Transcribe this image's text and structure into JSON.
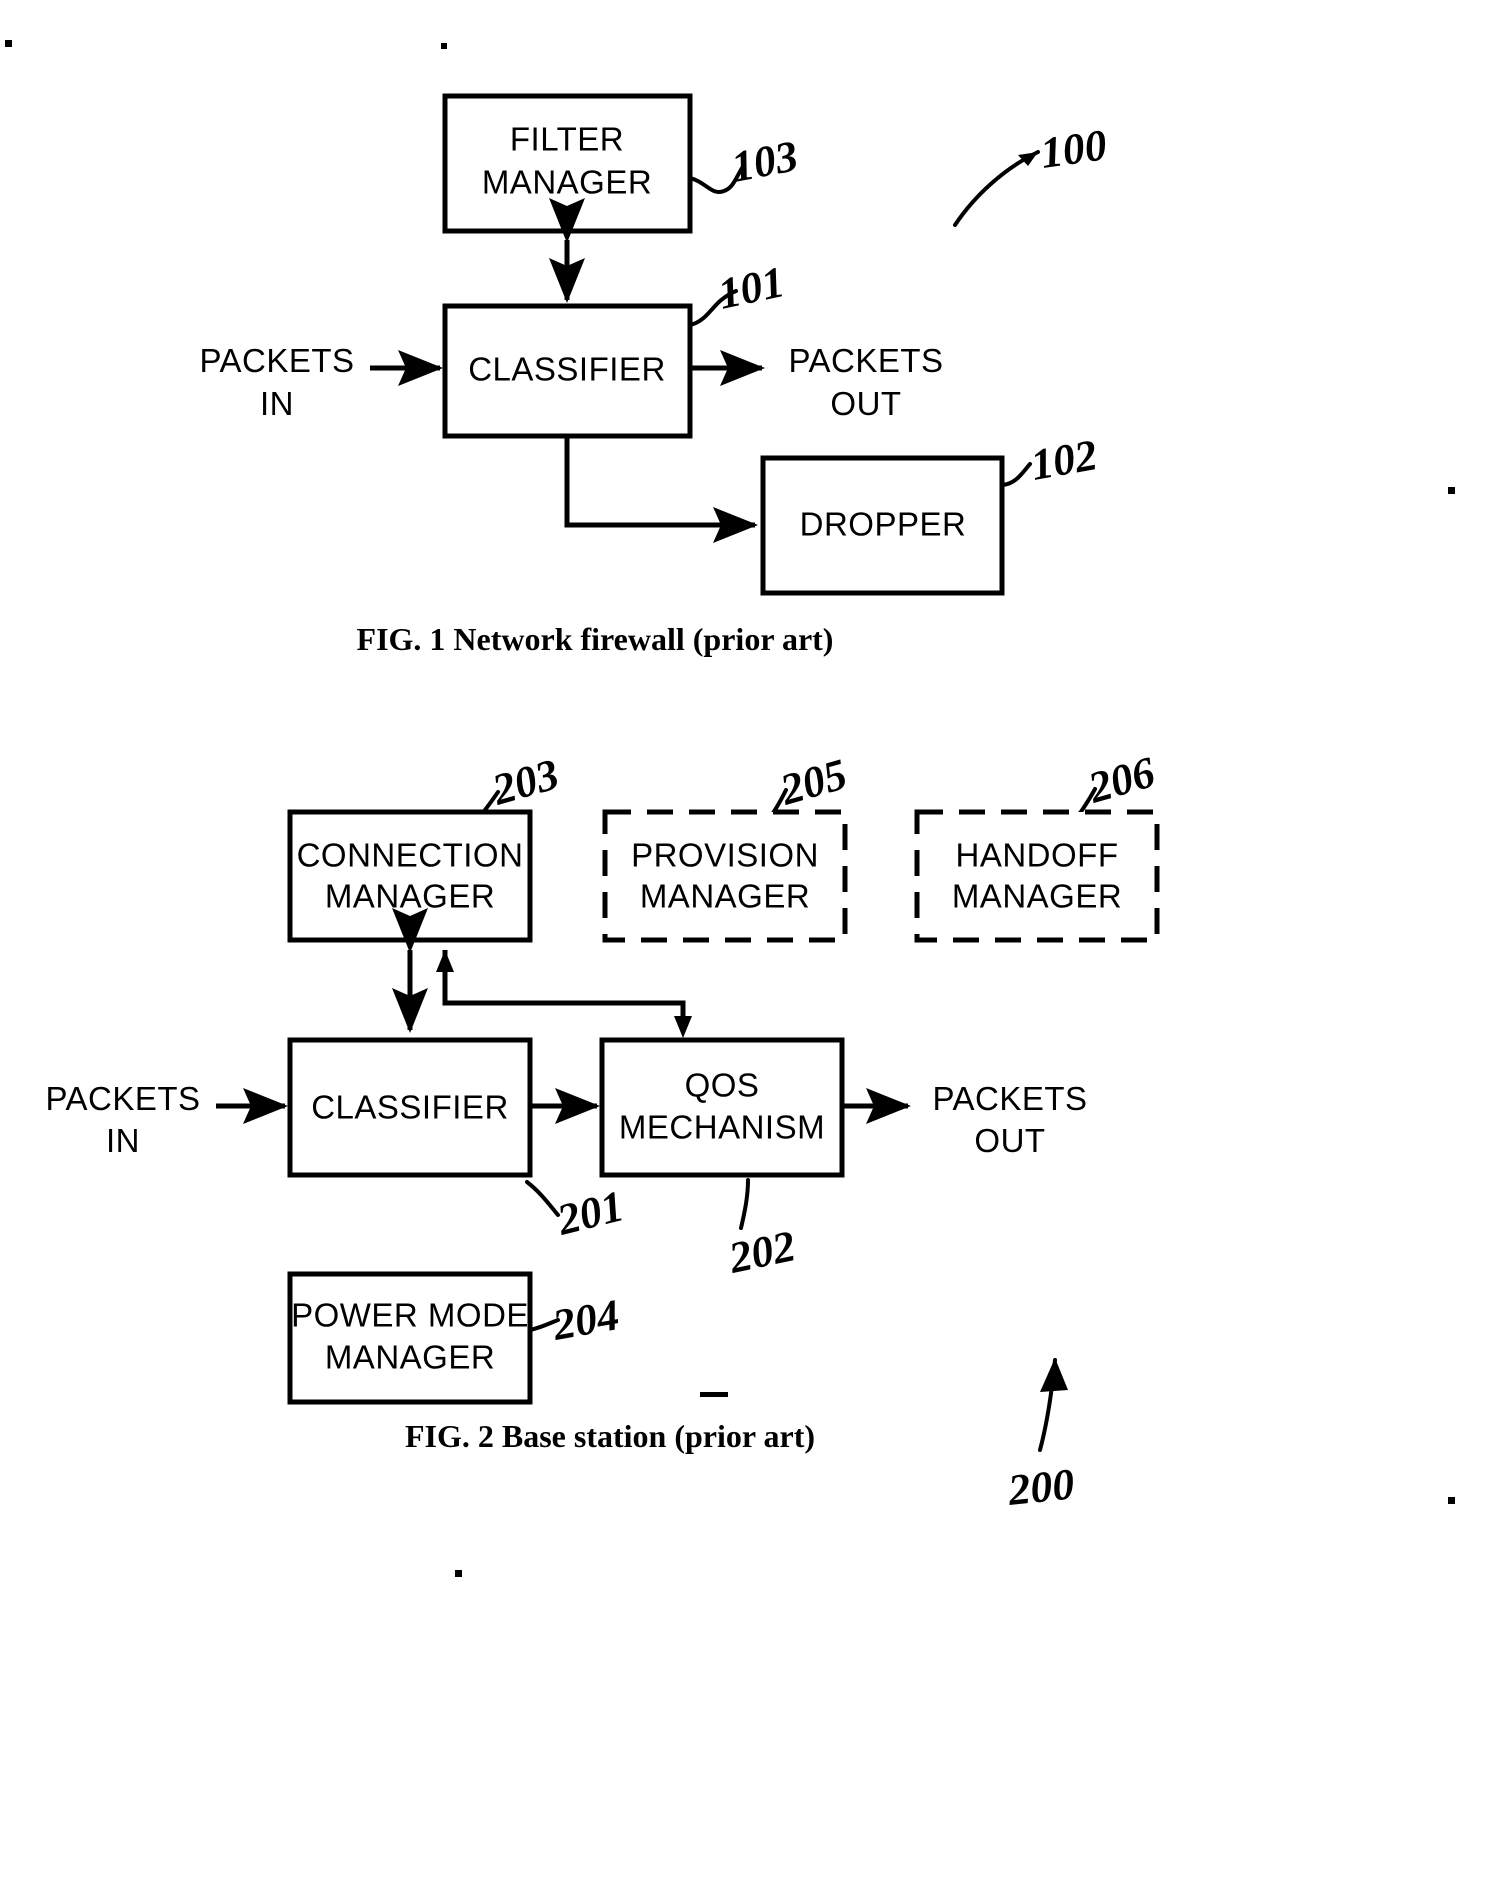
{
  "document": {
    "type": "patent-drawing-sheet",
    "background_color": "#ffffff",
    "ink_color": "#000000"
  },
  "figures": [
    {
      "id": "fig1",
      "caption": "FIG. 1 Network firewall (prior art)",
      "system_ref": "100",
      "blocks": [
        {
          "id": "filter-manager",
          "label_line1": "FILTER",
          "label_line2": "MANAGER",
          "ref": "103",
          "border": "solid"
        },
        {
          "id": "classifier",
          "label_line1": "CLASSIFIER",
          "label_line2": "",
          "ref": "101",
          "border": "solid"
        },
        {
          "id": "dropper",
          "label_line1": "DROPPER",
          "label_line2": "",
          "ref": "102",
          "border": "solid"
        }
      ],
      "flow_labels": [
        {
          "id": "packets-in",
          "line1": "PACKETS",
          "line2": "IN"
        },
        {
          "id": "packets-out",
          "line1": "PACKETS",
          "line2": "OUT"
        }
      ]
    },
    {
      "id": "fig2",
      "caption": "FIG. 2 Base station (prior art)",
      "system_ref": "200",
      "blocks": [
        {
          "id": "connection-manager",
          "label_line1": "CONNECTION",
          "label_line2": "MANAGER",
          "ref": "203",
          "border": "solid"
        },
        {
          "id": "provision-manager",
          "label_line1": "PROVISION",
          "label_line2": "MANAGER",
          "ref": "205",
          "border": "dashed"
        },
        {
          "id": "handoff-manager",
          "label_line1": "HANDOFF",
          "label_line2": "MANAGER",
          "ref": "206",
          "border": "dashed"
        },
        {
          "id": "classifier",
          "label_line1": "CLASSIFIER",
          "label_line2": "",
          "ref": "201",
          "border": "solid"
        },
        {
          "id": "qos-mechanism",
          "label_line1": "QOS",
          "label_line2": "MECHANISM",
          "ref": "202",
          "border": "solid"
        },
        {
          "id": "power-mode-manager",
          "label_line1": "POWER MODE",
          "label_line2": "MANAGER",
          "ref": "204",
          "border": "solid"
        }
      ],
      "flow_labels": [
        {
          "id": "packets-in",
          "line1": "PACKETS",
          "line2": "IN"
        },
        {
          "id": "packets-out",
          "line1": "PACKETS",
          "line2": "OUT"
        }
      ]
    }
  ],
  "fig1": {
    "caption": "FIG. 1 Network firewall (prior art)",
    "filter_manager_l1": "FILTER",
    "filter_manager_l2": "MANAGER",
    "filter_manager_ref": "103",
    "classifier": "CLASSIFIER",
    "classifier_ref": "101",
    "dropper": "DROPPER",
    "dropper_ref": "102",
    "packets_in_l1": "PACKETS",
    "packets_in_l2": "IN",
    "packets_out_l1": "PACKETS",
    "packets_out_l2": "OUT",
    "system_ref": "100"
  },
  "fig2": {
    "caption": "FIG. 2 Base station (prior art)",
    "connection_manager_l1": "CONNECTION",
    "connection_manager_l2": "MANAGER",
    "connection_manager_ref": "203",
    "provision_manager_l1": "PROVISION",
    "provision_manager_l2": "MANAGER",
    "provision_manager_ref": "205",
    "handoff_manager_l1": "HANDOFF",
    "handoff_manager_l2": "MANAGER",
    "handoff_manager_ref": "206",
    "classifier": "CLASSIFIER",
    "classifier_ref": "201",
    "qos_l1": "QOS",
    "qos_l2": "MECHANISM",
    "qos_ref": "202",
    "power_mode_l1": "POWER MODE",
    "power_mode_l2": "MANAGER",
    "power_mode_ref": "204",
    "packets_in_l1": "PACKETS",
    "packets_in_l2": "IN",
    "packets_out_l1": "PACKETS",
    "packets_out_l2": "OUT",
    "system_ref": "200"
  }
}
